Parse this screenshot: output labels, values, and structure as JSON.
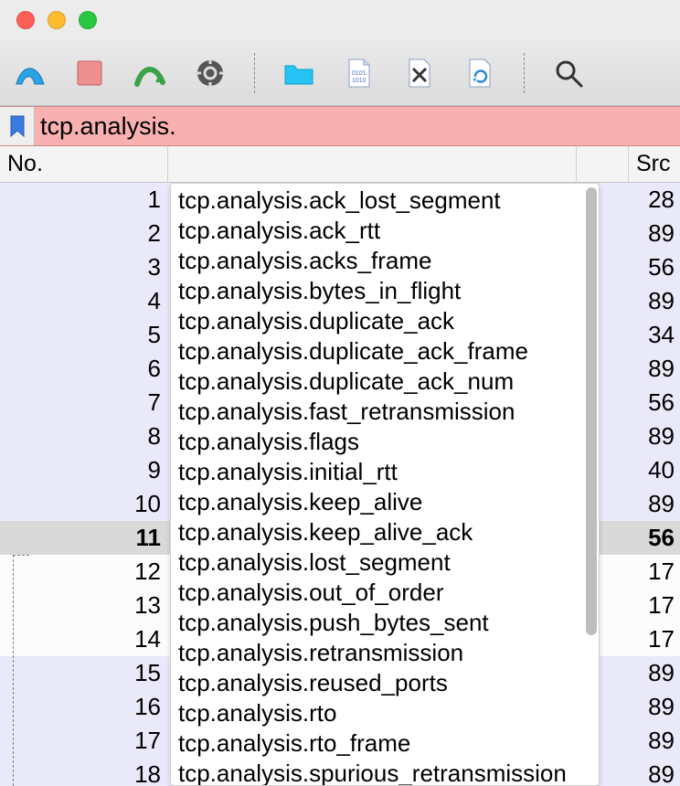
{
  "window": {
    "traffic": [
      "close",
      "minimize",
      "zoom"
    ]
  },
  "toolbar": {
    "icons": [
      "shark-fin-icon",
      "stop-record-icon",
      "restart-capture-icon",
      "settings-gear-icon",
      "open-folder-icon",
      "binary-page-icon",
      "close-file-icon",
      "reload-file-icon",
      "magnifier-icon"
    ]
  },
  "filter": {
    "value": "tcp.analysis.",
    "bg": "#f9b0b1"
  },
  "columns": {
    "no": "No.",
    "src": "Src"
  },
  "rows": [
    {
      "n": 1,
      "v": "28",
      "cls": "blue"
    },
    {
      "n": 2,
      "v": "89",
      "cls": "blue"
    },
    {
      "n": 3,
      "v": "56",
      "cls": "blue"
    },
    {
      "n": 4,
      "v": "89",
      "cls": "blue"
    },
    {
      "n": 5,
      "v": "34",
      "cls": "blue"
    },
    {
      "n": 6,
      "v": "89",
      "cls": "blue"
    },
    {
      "n": 7,
      "v": "56",
      "cls": "blue"
    },
    {
      "n": 8,
      "v": "89",
      "cls": "blue"
    },
    {
      "n": 9,
      "v": "40",
      "cls": "blue"
    },
    {
      "n": 10,
      "v": "89",
      "cls": "blue"
    },
    {
      "n": 11,
      "v": "56",
      "cls": "gray sel"
    },
    {
      "n": 12,
      "v": "17",
      "cls": "white"
    },
    {
      "n": 13,
      "v": "17",
      "cls": "white"
    },
    {
      "n": 14,
      "v": "17",
      "cls": "white"
    },
    {
      "n": 15,
      "v": "89",
      "cls": "blue"
    },
    {
      "n": 16,
      "v": "89",
      "cls": "blue"
    },
    {
      "n": 17,
      "v": "89",
      "cls": "blue"
    },
    {
      "n": 18,
      "v": "89",
      "cls": "blue"
    }
  ],
  "autocomplete": [
    "tcp.analysis.ack_lost_segment",
    "tcp.analysis.ack_rtt",
    "tcp.analysis.acks_frame",
    "tcp.analysis.bytes_in_flight",
    "tcp.analysis.duplicate_ack",
    "tcp.analysis.duplicate_ack_frame",
    "tcp.analysis.duplicate_ack_num",
    "tcp.analysis.fast_retransmission",
    "tcp.analysis.flags",
    "tcp.analysis.initial_rtt",
    "tcp.analysis.keep_alive",
    "tcp.analysis.keep_alive_ack",
    "tcp.analysis.lost_segment",
    "tcp.analysis.out_of_order",
    "tcp.analysis.push_bytes_sent",
    "tcp.analysis.retransmission",
    "tcp.analysis.reused_ports",
    "tcp.analysis.rto",
    "tcp.analysis.rto_frame",
    "tcp.analysis.spurious_retransmission"
  ]
}
